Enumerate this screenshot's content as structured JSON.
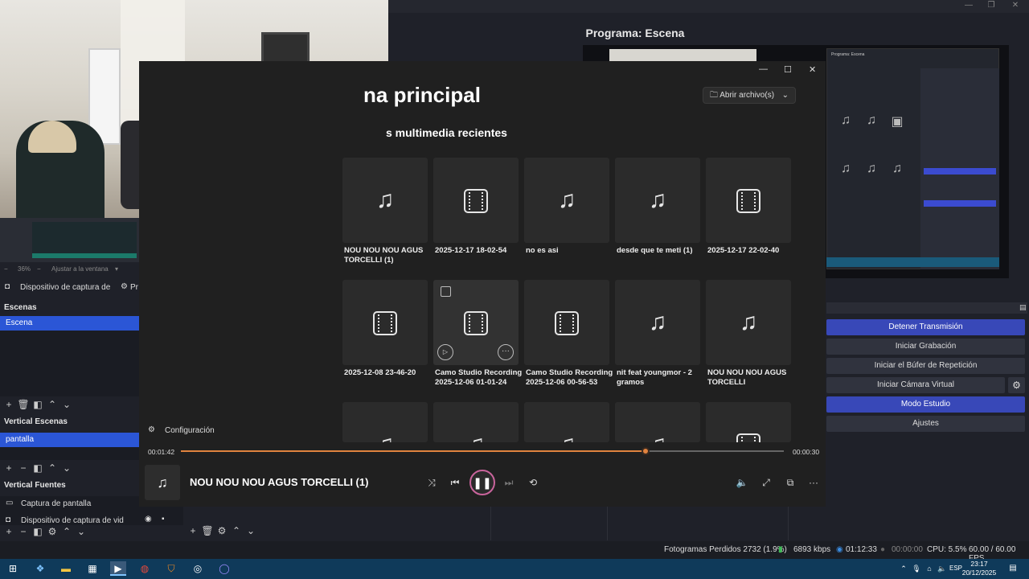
{
  "program": {
    "label": "Programa: Escena"
  },
  "left_panel": {
    "zoom": "36%",
    "fit_label": "Ajustar a la ventana",
    "source_device": "Dispositivo de captura de v",
    "source_props": "Pr",
    "scenes_title": "Escenas",
    "scene_selected": "Escena",
    "vscenes_title": "Vertical Escenas",
    "vscene_selected": "pantalla",
    "vsources_title": "Vertical Fuentes",
    "vsources": [
      "Captura de pantalla",
      "Dispositivo de captura de video"
    ]
  },
  "controls": {
    "stop_stream": "Detener Transmisión",
    "start_record": "Iniciar Grabación",
    "replay_buffer": "Iniciar el Búfer de Repetición",
    "virtual_cam": "Iniciar Cámara Virtual",
    "studio_mode": "Modo Estudio",
    "settings": "Ajustes"
  },
  "player": {
    "title": "na principal",
    "recent_title": "s multimedia recientes",
    "open_file": "Abrir archivo(s)",
    "config_label": "Configuración",
    "tiles": [
      {
        "type": "audio",
        "caption": "NOU NOU NOU AGUS TORCELLI (1)"
      },
      {
        "type": "video",
        "caption": "2025-12-17 18-02-54"
      },
      {
        "type": "audio",
        "caption": "no es asi"
      },
      {
        "type": "audio",
        "caption": "desde que te  meti (1)"
      },
      {
        "type": "video",
        "caption": "2025-12-17 22-02-40"
      },
      {
        "type": "video",
        "caption": "2025-12-08 23-46-20"
      },
      {
        "type": "video",
        "caption": "Camo Studio Recording 2025-12-06 01-01-24"
      },
      {
        "type": "video",
        "caption": "Camo Studio Recording 2025-12-06 00-56-53"
      },
      {
        "type": "audio",
        "caption": "nit feat youngmor - 2 gramos"
      },
      {
        "type": "audio",
        "caption": "NOU NOU NOU AGUS TORCELLI"
      }
    ],
    "time_current": "00:01:42",
    "time_remaining": "00:00:30",
    "progress": 0.77,
    "now_playing": "NOU NOU NOU AGUS TORCELLI (1)"
  },
  "status": {
    "dropped_frames": "Fotogramas Perdidos 2732 (1.9%)",
    "bitrate": "6893 kbps",
    "stream_time": "01:12:33",
    "record_time": "00:00:00",
    "cpu": "CPU: 5.5%",
    "fps": "60.00 / 60.00 FPS"
  },
  "taskbar": {
    "lang": "ESP",
    "time": "23:17",
    "date": "20/12/2025"
  },
  "colors": {
    "accent_blue": "#2b56d6",
    "seek": "#e0833f",
    "pause_ring": "#c9649c"
  }
}
